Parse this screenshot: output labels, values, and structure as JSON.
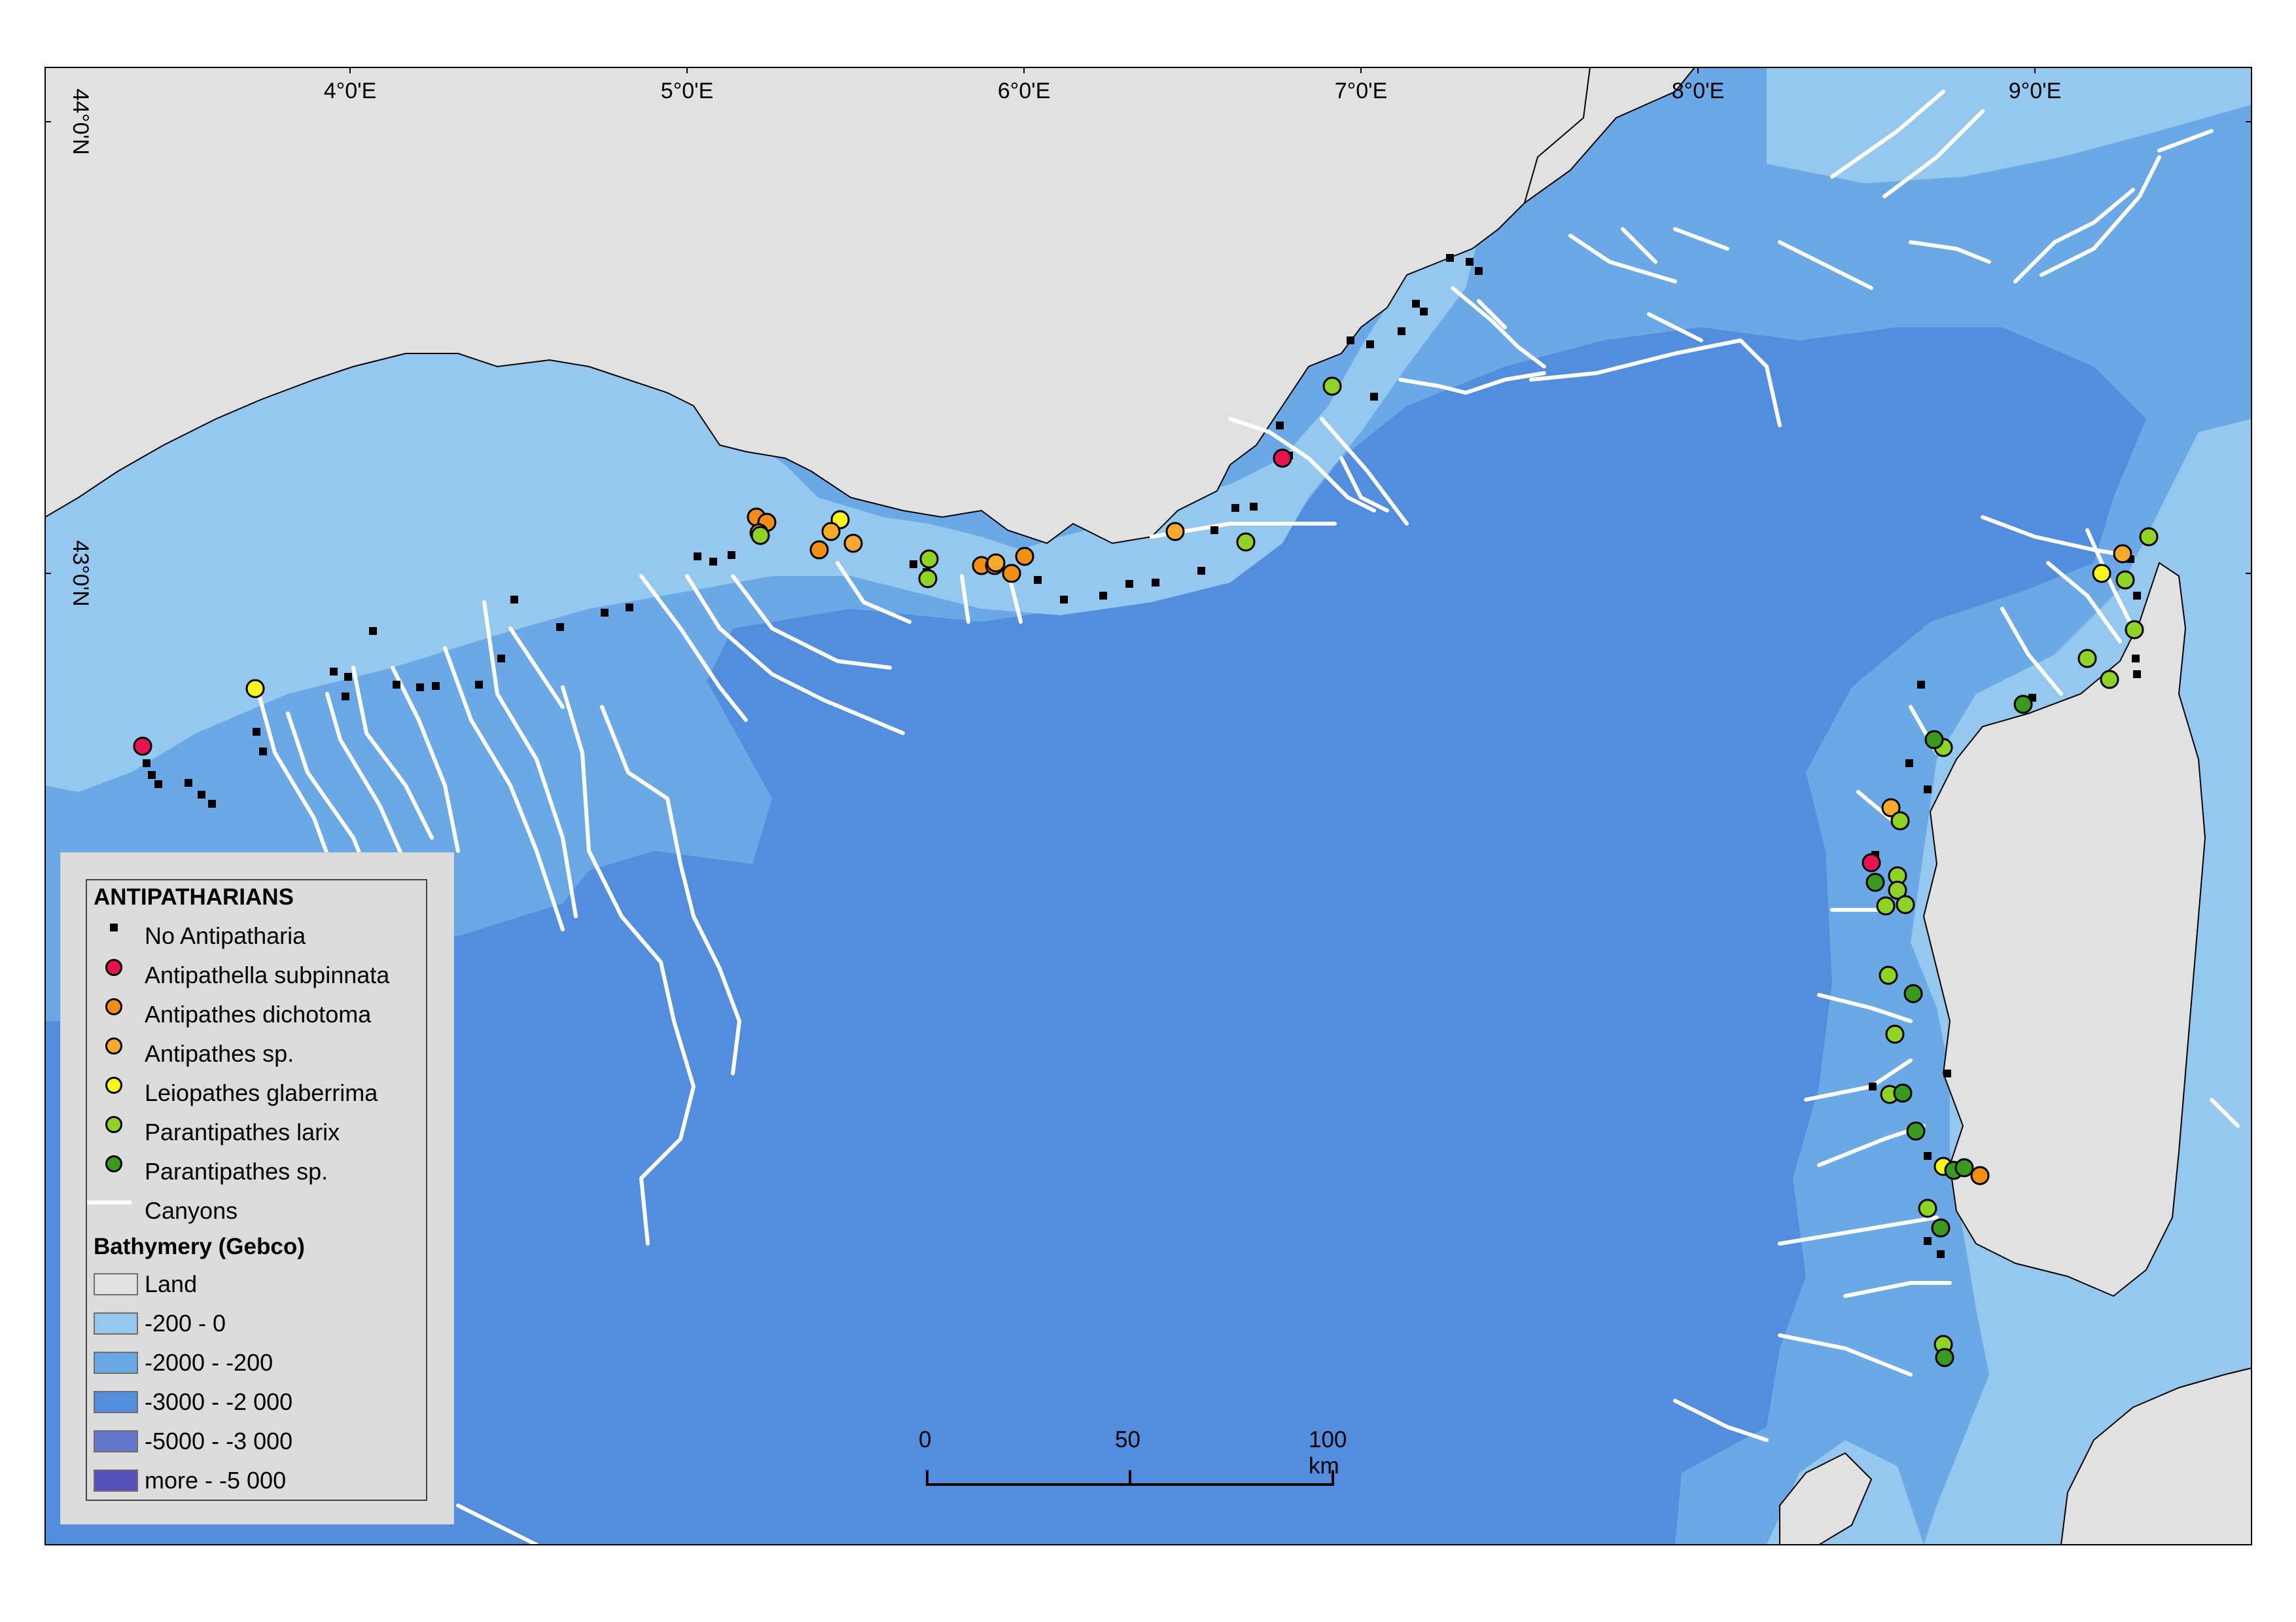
{
  "map": {
    "lon_labels": [
      "4°0'E",
      "5°0'E",
      "6°0'E",
      "7°0'E",
      "8°0'E",
      "9°0'E"
    ],
    "lat_labels": [
      "44°0'N",
      "43°0'N"
    ],
    "colors": {
      "land": "#e1e1e1",
      "depth_0_200": "#95c8ef",
      "depth_200_2000": "#6aa8e6",
      "depth_2000_3000": "#528edd",
      "depth_3000_5000": "#6277c9",
      "depth_more_5000": "#5451b9",
      "canyon": "#ffffff"
    }
  },
  "legend": {
    "title": "ANTIPATHARIANS",
    "species": [
      {
        "label": "No Antipatharia",
        "symbol": "square",
        "color": "#000000"
      },
      {
        "label": "Antipathella subpinnata",
        "symbol": "circle",
        "color": "#e8124f"
      },
      {
        "label": "Antipathes dichotoma",
        "symbol": "circle",
        "color": "#f28f12"
      },
      {
        "label": "Antipathes sp.",
        "symbol": "circle",
        "color": "#f8a92b"
      },
      {
        "label": "Leiopathes glaberrima",
        "symbol": "circle",
        "color": "#f9f51a"
      },
      {
        "label": "Parantipathes larix",
        "symbol": "circle",
        "color": "#8fd325"
      },
      {
        "label": "Parantipathes sp.",
        "symbol": "circle",
        "color": "#3a9a1e"
      }
    ],
    "canyons_label": "Canyons",
    "bathymetry_title": "Bathymery (Gebco)",
    "bathymetry": [
      {
        "label": "Land",
        "color": "#e1e1e1"
      },
      {
        "label": "-200 - 0",
        "color": "#95c8ef"
      },
      {
        "label": "-2000 - -200",
        "color": "#6aa8e6"
      },
      {
        "label": "-3000 - -2 000",
        "color": "#528edd"
      },
      {
        "label": "-5000 - -3 000",
        "color": "#6277c9"
      },
      {
        "label": "more - -5 000",
        "color": "#5451b9"
      }
    ]
  },
  "scale_bar": {
    "labels": [
      "0",
      "50",
      "100 km"
    ]
  }
}
